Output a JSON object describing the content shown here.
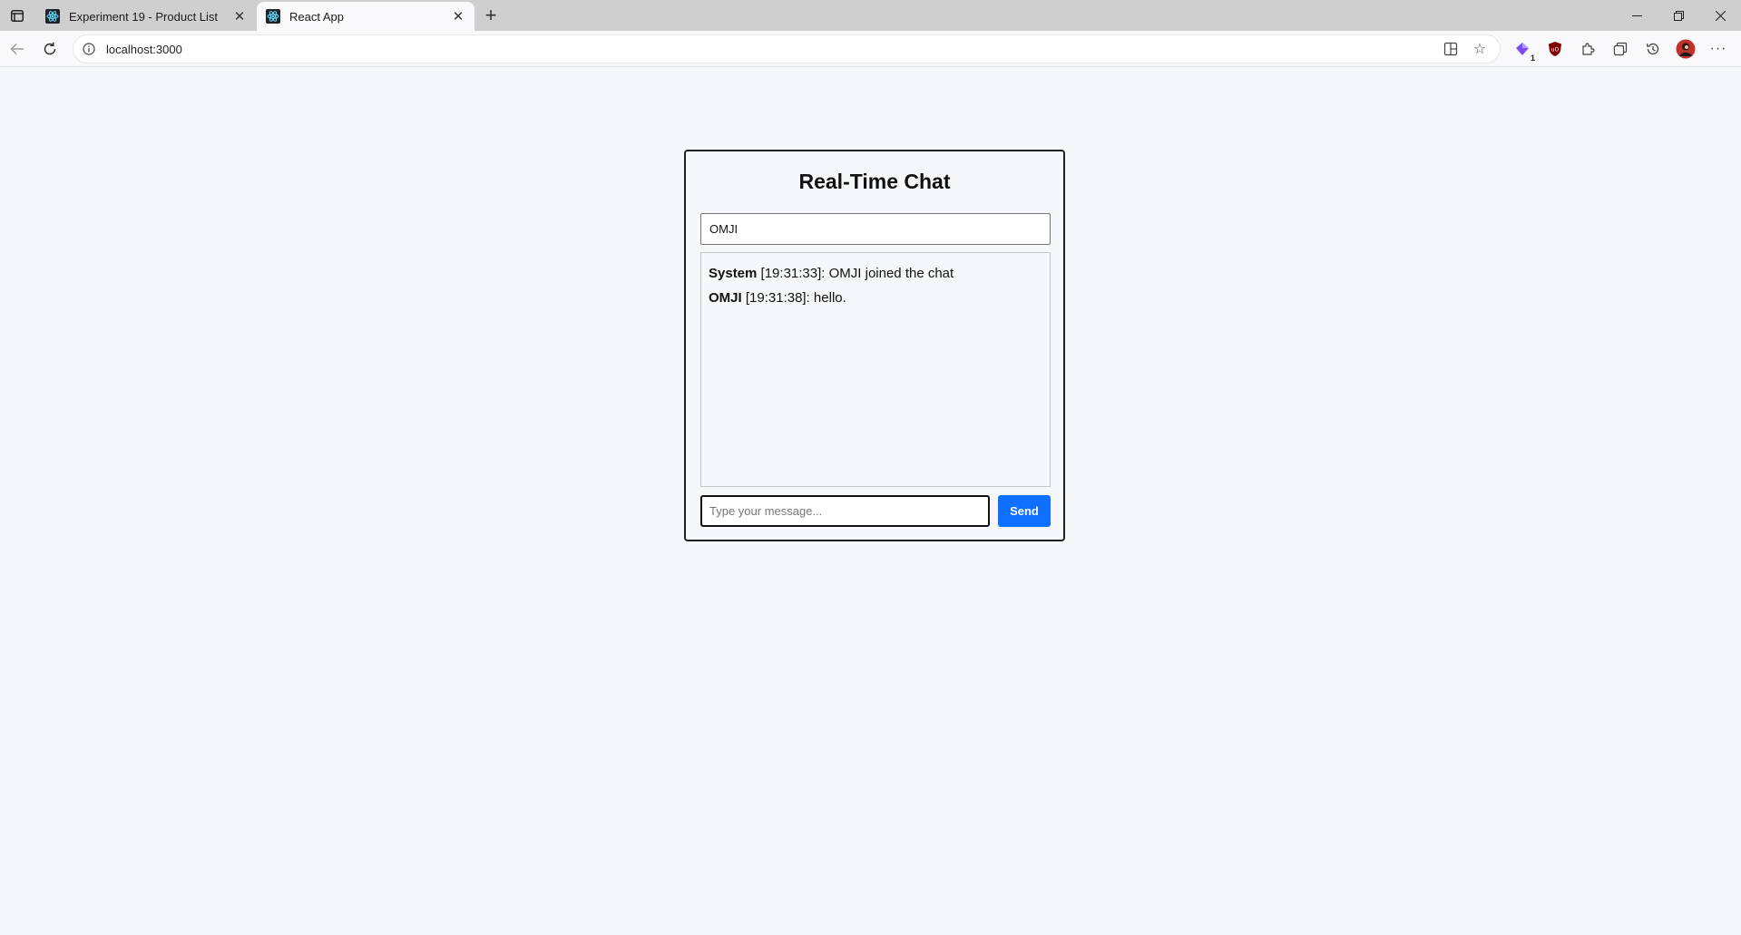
{
  "browser": {
    "tabs": [
      {
        "title": "Experiment 19 - Product List",
        "active": false
      },
      {
        "title": "React App",
        "active": true
      }
    ],
    "url": "localhost:3000",
    "extension_badge": "1"
  },
  "chat": {
    "title": "Real-Time Chat",
    "username": "OMJI",
    "messages": [
      {
        "sender": "System",
        "time": "[19:31:33]",
        "text": ": OMJI joined the chat"
      },
      {
        "sender": "OMJI",
        "time": "[19:31:38]",
        "text": ": hello."
      }
    ],
    "message_placeholder": "Type your message...",
    "send_label": "Send"
  },
  "colors": {
    "accent": "#0f6fff",
    "page_background": "#f6f7fa"
  }
}
